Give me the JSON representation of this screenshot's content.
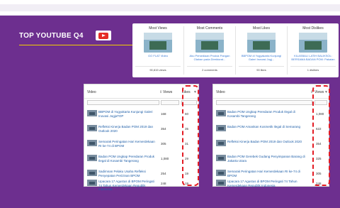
{
  "header": {
    "title": "TOP YOUTUBE Q4",
    "icon": "youtube-icon"
  },
  "cards": [
    {
      "title": "Most Views",
      "caption": "GO FLAT Video",
      "stat": "90,815 views"
    },
    {
      "title": "Most Comments",
      "caption": "Aku Persediaan Produk Pangan Olahan pada Direktorat...",
      "stat": "2 comments"
    },
    {
      "title": "Most Likes",
      "caption": "BBPOM di Yogyakarta Kunjungi Galeri Inovasi Jogj...",
      "stat": "90 likes"
    },
    {
      "title": "Most Dislikes",
      "caption": "KILASBALI LATIH BALIKSOL: BERSAMA BADAN POM: Pakaian Untu...",
      "stat": "1 dislikes"
    }
  ],
  "table_left": {
    "col_video": "Video",
    "col_views": "Views",
    "col_likes": "Likes",
    "rows": [
      {
        "title": "BBPOM di Yogyakarta Kunjungi Galeri Inovasi JogjaTOP",
        "views": "168",
        "likes": "60"
      },
      {
        "title": "Refleksi Kinerja Badan POM 2019 dan Outlook 2020",
        "views": "354",
        "likes": "35"
      },
      {
        "title": "Semarak Peringatan Hari Kemerdekaan RI ke-74 di BPOM",
        "views": "305",
        "likes": "31"
      },
      {
        "title": "Badan POM Ungkap Peredaran Produk Ilegal di Kosambi Tangerang",
        "views": "1,080",
        "likes": "29"
      },
      {
        "title": "Sadimnan Pelaku Usaha Refleksi Penyepatan Perizinan BPOM",
        "views": "254",
        "likes": "19"
      },
      {
        "title": "Upacara 17 Agustus di BPOM Peringati 74 Tahun Kemerdekaan Republik Indonesia",
        "views": "248",
        "likes": "19"
      }
    ]
  },
  "table_right": {
    "col_video": "Video",
    "col_views": "Views",
    "rows": [
      {
        "title": "Badan POM Ungkap Peredaran Produk Ilegal di Kosambi Tangerang",
        "views": "1,080"
      },
      {
        "title": "Badan POM Amankan Kosmetik Ilegal di Semarang",
        "views": "622"
      },
      {
        "title": "Refleksi Kinerja Badan POM 2019 dan Outlook 2020",
        "views": "354"
      },
      {
        "title": "Badan POM Gerebek Gudang Penyimpanan Barang di Jakarta Utara",
        "views": "325"
      },
      {
        "title": "Semarak Peringatan Hari Kemerdekaan RI ke-74 di BPOM",
        "views": "305"
      },
      {
        "title": "Upacara 17 Agustus di BPOM Peringati 74 Tahun Kemerdekaan Republik Indonesia",
        "views": "248"
      }
    ]
  },
  "colors": {
    "band": "#6d2f8f",
    "accent": "#f1d000",
    "highlight": "#e31b23",
    "link": "#1f5fa8"
  }
}
